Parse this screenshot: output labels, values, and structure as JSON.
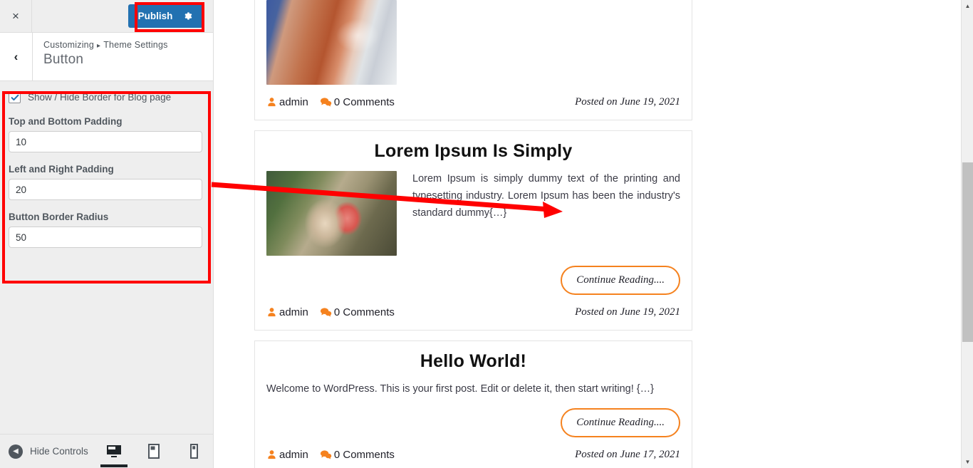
{
  "sidebar": {
    "close_label": "×",
    "publish_label": "Publish",
    "gear_icon": "gear-icon",
    "back_label": "‹",
    "breadcrumb": {
      "root": "Customizing",
      "separator": "▸",
      "section": "Theme Settings"
    },
    "panel_title": "Button",
    "controls": {
      "checkbox": {
        "label": "Show / Hide Border for Blog page",
        "checked": true
      },
      "fields": [
        {
          "label": "Top and Bottom Padding",
          "value": "10"
        },
        {
          "label": "Left and Right Padding",
          "value": "20"
        },
        {
          "label": "Button Border Radius",
          "value": "50"
        }
      ]
    },
    "footer": {
      "hide_controls_label": "Hide Controls",
      "devices": [
        {
          "name": "desktop",
          "active": true
        },
        {
          "name": "tablet",
          "active": false
        },
        {
          "name": "mobile",
          "active": false
        }
      ]
    }
  },
  "annotations": {
    "highlight_color": "#ff0000",
    "arrow_color": "#ff0000",
    "targets": [
      "publish-button",
      "button-controls-panel",
      "continue-reading-button"
    ]
  },
  "preview": {
    "posts": [
      {
        "title": "",
        "excerpt": "",
        "has_image": true,
        "image_kind": "flag",
        "author": "admin",
        "comments": "0 Comments",
        "date": "Posted on June 19, 2021",
        "cta": "",
        "show_cta": false
      },
      {
        "title": "Lorem Ipsum Is Simply",
        "excerpt": "Lorem Ipsum is simply dummy text of the printing and typesetting industry. Lorem Ipsum has been the industry's standard dummy{…}",
        "has_image": true,
        "image_kind": "family",
        "author": "admin",
        "comments": "0 Comments",
        "date": "Posted on June 19, 2021",
        "cta": "Continue Reading....",
        "show_cta": true
      },
      {
        "title": "Hello World!",
        "excerpt": "Welcome to WordPress. This is your first post. Edit or delete it, then start writing! {…}",
        "has_image": false,
        "image_kind": "",
        "author": "admin",
        "comments": "0 Comments",
        "date": "Posted on June 17, 2021",
        "cta": "Continue Reading....",
        "show_cta": true
      }
    ],
    "meta_icons": {
      "author": "user-icon",
      "comments": "comment-bubble-icon"
    },
    "accent_color": "#f5821f"
  },
  "scrollbar": {
    "up_arrow": "▲",
    "down_arrow": "▼"
  }
}
